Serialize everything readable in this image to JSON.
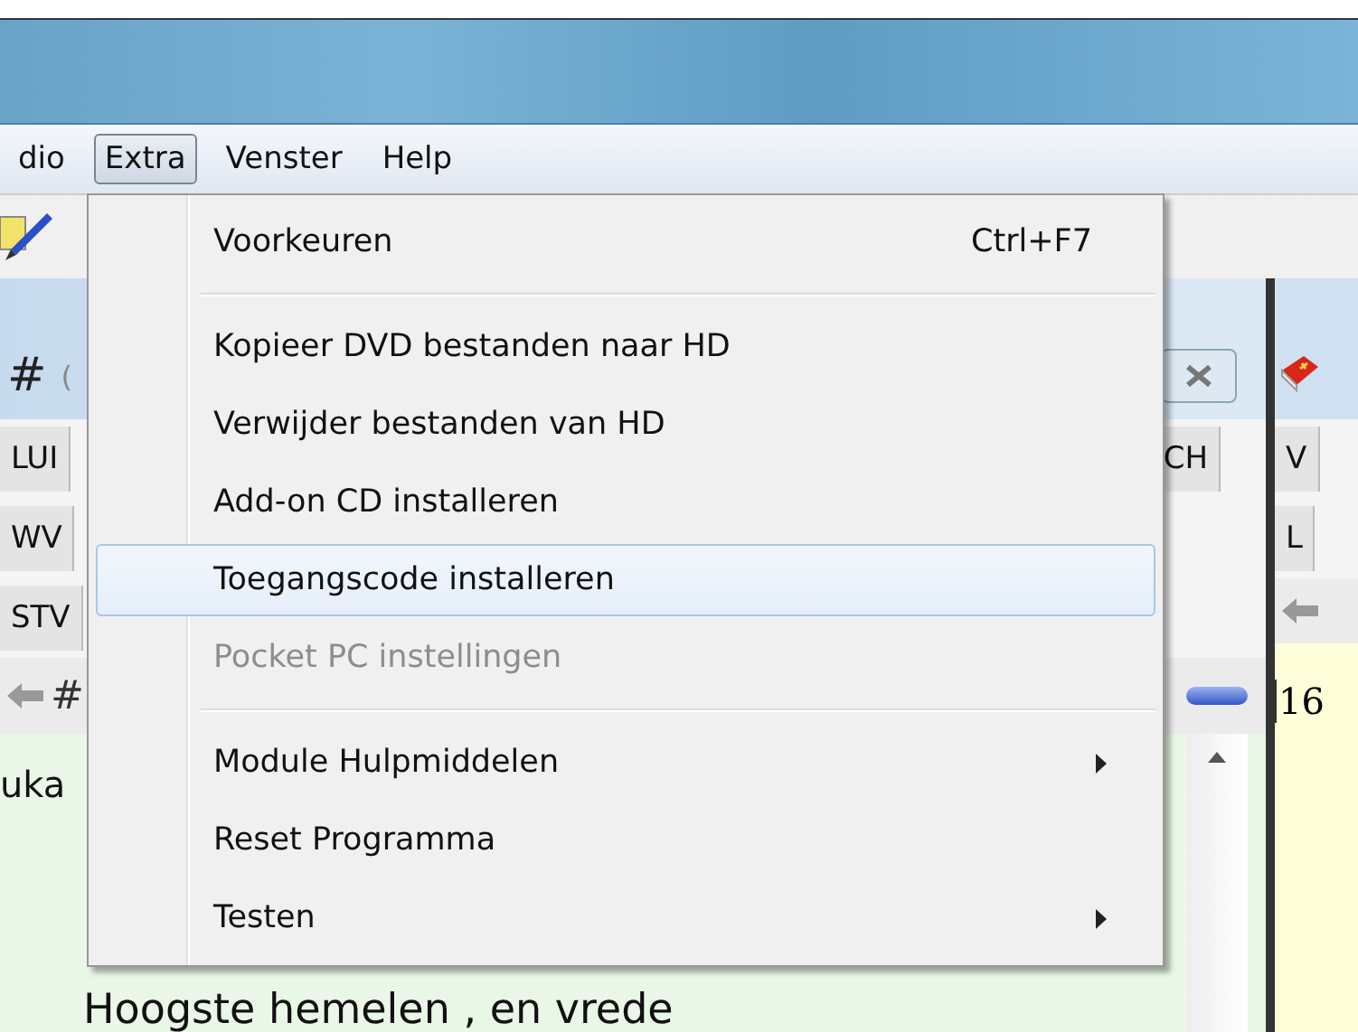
{
  "menubar": [
    {
      "label": "dio",
      "selected": false
    },
    {
      "label": "Extra",
      "selected": true
    },
    {
      "label": "Venster",
      "selected": false
    },
    {
      "label": "Help",
      "selected": false
    }
  ],
  "left_panel": {
    "header_symbol": "#",
    "header_text": "(",
    "tab_rows": [
      [
        "LUI",
        "CH"
      ],
      [
        "WV"
      ],
      [
        "STV"
      ]
    ],
    "nav_text": "#",
    "content": [
      "uka",
      "Hoogste hemelen , en vrede"
    ]
  },
  "right_panel": {
    "tab_rows": [
      "V",
      "L"
    ],
    "content": "16"
  },
  "menu": [
    {
      "kind": "item",
      "label": "Voorkeuren",
      "shortcut": "Ctrl+F7",
      "selected": false,
      "disabled": false,
      "submenu": false
    },
    {
      "kind": "separator"
    },
    {
      "kind": "item",
      "label": "Kopieer DVD bestanden naar HD",
      "selected": false,
      "disabled": false,
      "submenu": false
    },
    {
      "kind": "item",
      "label": "Verwijder bestanden van HD",
      "selected": false,
      "disabled": false,
      "submenu": false
    },
    {
      "kind": "item",
      "label": "Add-on CD installeren",
      "selected": false,
      "disabled": false,
      "submenu": false
    },
    {
      "kind": "item",
      "label": "Toegangscode installeren",
      "selected": true,
      "disabled": false,
      "submenu": false
    },
    {
      "kind": "item",
      "label": "Pocket PC instellingen",
      "selected": false,
      "disabled": true,
      "submenu": false
    },
    {
      "kind": "separator"
    },
    {
      "kind": "item",
      "label": "Module Hulpmiddelen",
      "selected": false,
      "disabled": false,
      "submenu": true
    },
    {
      "kind": "item",
      "label": "Reset Programma",
      "selected": false,
      "disabled": false,
      "submenu": false
    },
    {
      "kind": "item",
      "label": "Testen",
      "selected": false,
      "disabled": false,
      "submenu": true
    }
  ]
}
